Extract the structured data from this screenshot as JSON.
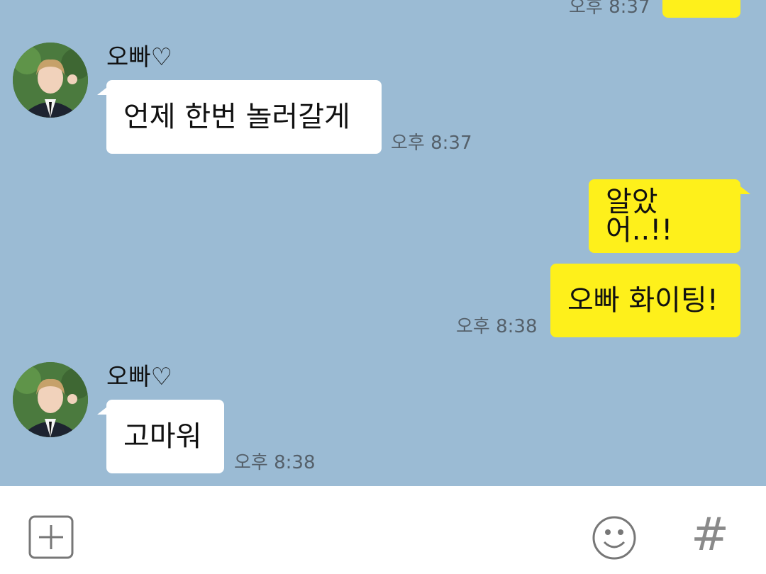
{
  "messages": {
    "top_time": "오후 8:37",
    "group1": {
      "sender": "오빠♡",
      "text": "언제 한번 놀러갈게",
      "time": "오후 8:37"
    },
    "mine1": {
      "text": "알았어..!!"
    },
    "mine2": {
      "text": "오빠 화이팅!",
      "time": "오후 8:38"
    },
    "group2": {
      "sender": "오빠♡",
      "text": "고마워",
      "time": "오후 8:38"
    }
  },
  "input_bar": {
    "icons": [
      "plus-icon",
      "emoji-icon",
      "hash-icon"
    ],
    "hash_label": "#"
  },
  "colors": {
    "background": "#9bbbd4",
    "incoming_bubble": "#ffffff",
    "outgoing_bubble": "#fef01b"
  }
}
